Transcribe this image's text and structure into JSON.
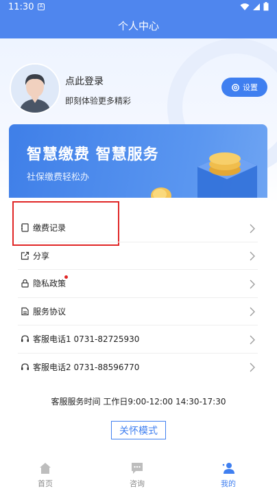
{
  "status": {
    "time": "11:30"
  },
  "header": {
    "title": "个人中心"
  },
  "profile": {
    "login_title": "点此登录",
    "login_subtitle": "即刻体验更多精彩",
    "settings_label": "设置"
  },
  "banner": {
    "title": "智慧缴费  智慧服务",
    "subtitle": "社保缴费轻松办"
  },
  "menu": [
    {
      "label": "缴费记录",
      "icon": "receipt-icon"
    },
    {
      "label": "分享",
      "icon": "share-icon"
    },
    {
      "label": "隐私政策",
      "icon": "lock-icon",
      "has_dot": true
    },
    {
      "label": "服务协议",
      "icon": "document-icon"
    },
    {
      "label": "客服电话1 0731-82725930",
      "icon": "headset-icon"
    },
    {
      "label": "客服电话2 0731-88596770",
      "icon": "headset-icon"
    }
  ],
  "footer": {
    "service_time": "客服服务时间 工作日9:00-12:00 14:30-17:30",
    "care_mode": "关怀模式"
  },
  "tabbar": [
    {
      "label": "首页",
      "icon": "home-icon",
      "active": false
    },
    {
      "label": "咨询",
      "icon": "chat-icon",
      "active": false
    },
    {
      "label": "我的",
      "icon": "user-icon",
      "active": true
    }
  ],
  "colors": {
    "primary": "#3f7ff0",
    "header": "#4f86ee",
    "highlight": "#e02525"
  }
}
